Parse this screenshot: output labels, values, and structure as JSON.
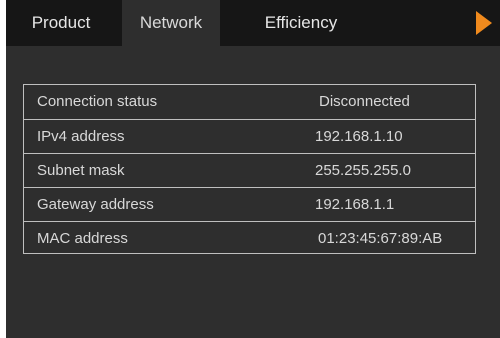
{
  "tabs": [
    {
      "label": "Product"
    },
    {
      "label": "Network"
    },
    {
      "label": "Efficiency"
    }
  ],
  "active_tab": "Network",
  "accent_color": "#f08a1d",
  "next_icon": "play-arrow-icon",
  "network": {
    "rows": [
      {
        "label": "Connection status",
        "value": "Disconnected"
      },
      {
        "label": "IPv4 address",
        "value": "192.168.1.10"
      },
      {
        "label": "Subnet mask",
        "value": "255.255.255.0"
      },
      {
        "label": "Gateway address",
        "value": "192.168.1.1"
      },
      {
        "label": "MAC address",
        "value": "01:23:45:67:89:AB"
      }
    ]
  }
}
